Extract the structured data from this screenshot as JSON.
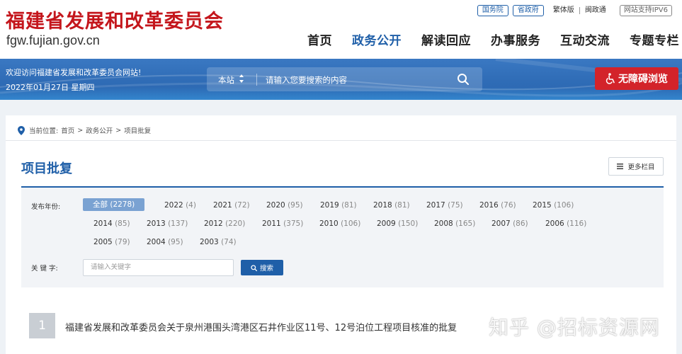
{
  "header": {
    "site_title": "福建省发展和改革委员会",
    "site_url": "fgw.fujian.gov.cn",
    "top_links": {
      "guowuyuan": "国务院",
      "shengzhengfu": "省政府",
      "fanti": "繁体版",
      "minnanhua": "闽政通",
      "ipv6": "网站支持IPV6"
    },
    "nav": [
      "首页",
      "政务公开",
      "解读回应",
      "办事服务",
      "互动交流",
      "专题专栏"
    ],
    "nav_active_index": 1
  },
  "banner": {
    "welcome": "欢迎访问福建省发展和改革委员会网站!",
    "date": "2022年01月27日 星期四",
    "search_scope": "本站",
    "search_placeholder": "请输入您要搜索的内容",
    "accessibility_label": "无障碍浏览"
  },
  "breadcrumb": {
    "prefix": "当前位置:",
    "items": [
      "首页",
      "政务公开",
      "项目批复"
    ],
    "separator": ">"
  },
  "page": {
    "title": "项目批复",
    "more_label": "更多栏目"
  },
  "filter": {
    "year_label": "发布年份:",
    "keyword_label": "关 键 字:",
    "keyword_placeholder": "请输入关键字",
    "search_button": "搜索",
    "years": [
      {
        "label": "全部",
        "count": "(2278)",
        "active": true
      },
      {
        "label": "2022",
        "count": "(4)"
      },
      {
        "label": "2021",
        "count": "(72)"
      },
      {
        "label": "2020",
        "count": "(95)"
      },
      {
        "label": "2019",
        "count": "(81)"
      },
      {
        "label": "2018",
        "count": "(81)"
      },
      {
        "label": "2017",
        "count": "(75)"
      },
      {
        "label": "2016",
        "count": "(76)"
      },
      {
        "label": "2015",
        "count": "(106)"
      },
      {
        "label": "2014",
        "count": "(85)"
      },
      {
        "label": "2013",
        "count": "(137)"
      },
      {
        "label": "2012",
        "count": "(220)"
      },
      {
        "label": "2011",
        "count": "(375)"
      },
      {
        "label": "2010",
        "count": "(106)"
      },
      {
        "label": "2009",
        "count": "(150)"
      },
      {
        "label": "2008",
        "count": "(165)"
      },
      {
        "label": "2007",
        "count": "(86)"
      },
      {
        "label": "2006",
        "count": "(116)"
      },
      {
        "label": "2005",
        "count": "(79)"
      },
      {
        "label": "2004",
        "count": "(95)"
      },
      {
        "label": "2003",
        "count": "(74)"
      }
    ]
  },
  "list": [
    {
      "number": "1",
      "title": "福建省发展和改革委员会关于泉州港围头湾港区石井作业区11号、12号泊位工程项目核准的批复"
    }
  ],
  "watermark": "知乎 @招标资源网",
  "colors": {
    "brand_red": "#c4161c",
    "nav_blue": "#1f5fa8",
    "banner_blue": "#2f6cb6",
    "accessibility_red": "#d3232a",
    "active_year_bg": "#7aa2d2"
  }
}
